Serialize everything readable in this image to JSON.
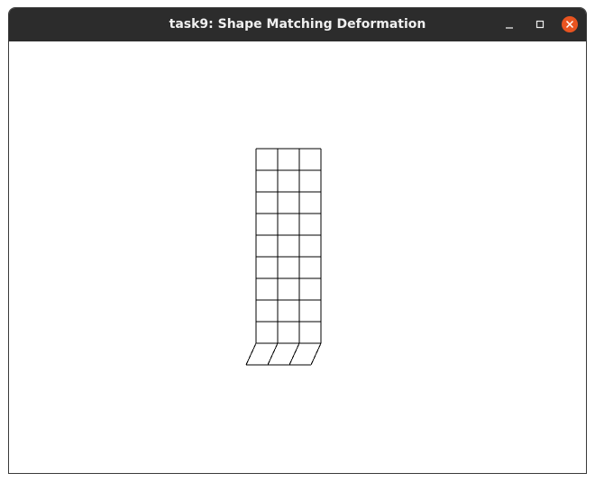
{
  "window": {
    "title": "task9: Shape Matching Deformation"
  },
  "titlebar_buttons": {
    "minimize_icon": "minimize-icon",
    "maximize_icon": "maximize-icon",
    "close_icon": "close-icon",
    "close_color": "#e95420"
  },
  "scene": {
    "background": "#ffffff",
    "line_color": "#000000",
    "grid_columns": 3,
    "grid_rows": 10
  }
}
